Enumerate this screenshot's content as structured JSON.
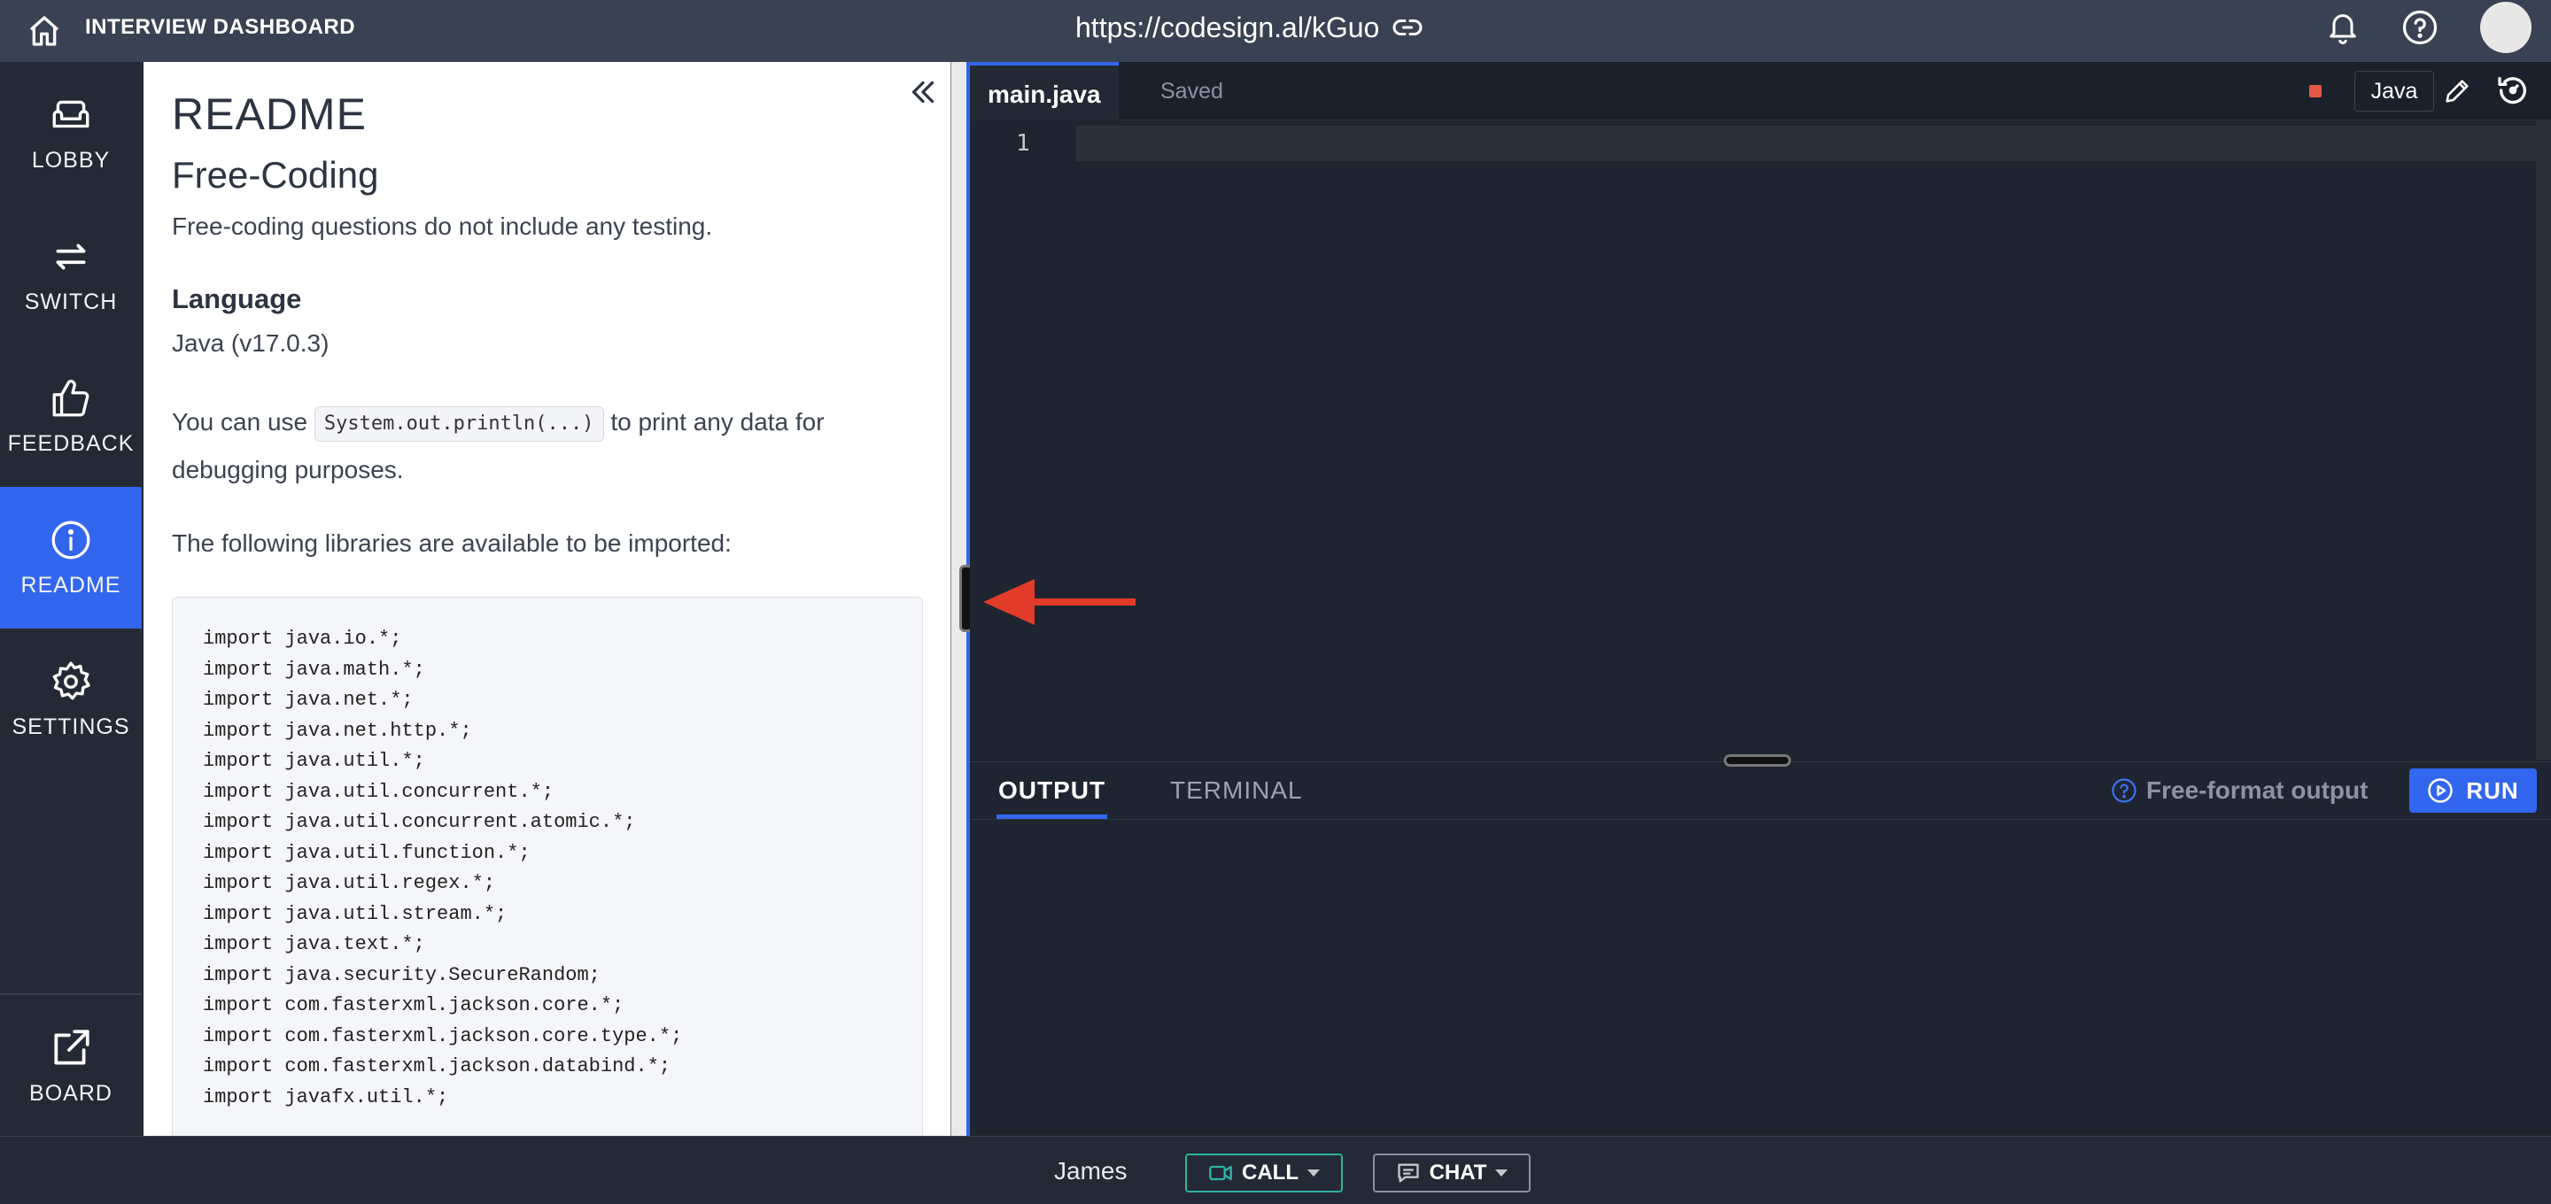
{
  "header": {
    "app_title": "INTERVIEW DASHBOARD",
    "url": "https://codesign.al/kGuo"
  },
  "sidebar": {
    "items": [
      {
        "label": "LOBBY",
        "icon": "sofa-icon"
      },
      {
        "label": "SWITCH",
        "icon": "swap-arrows-icon"
      },
      {
        "label": "FEEDBACK",
        "icon": "thumbs-up-icon"
      },
      {
        "label": "README",
        "icon": "info-icon",
        "active": true
      },
      {
        "label": "SETTINGS",
        "icon": "gear-icon"
      }
    ],
    "board": {
      "label": "BOARD",
      "icon": "external-link-icon"
    }
  },
  "readme": {
    "title": "README",
    "heading": "Free-Coding",
    "intro": "Free-coding questions do not include any testing.",
    "language_heading": "Language",
    "language_value": "Java (v17.0.3)",
    "debug_prefix": "You can use",
    "debug_code": "System.out.println(...)",
    "debug_suffix": "to print any data for debugging purposes.",
    "libraries_intro": "The following libraries are available to be imported:",
    "imports": [
      "import java.io.*;",
      "import java.math.*;",
      "import java.net.*;",
      "import java.net.http.*;",
      "import java.util.*;",
      "import java.util.concurrent.*;",
      "import java.util.concurrent.atomic.*;",
      "import java.util.function.*;",
      "import java.util.regex.*;",
      "import java.util.stream.*;",
      "import java.text.*;",
      "import java.security.SecureRandom;",
      "import com.fasterxml.jackson.core.*;",
      "import com.fasterxml.jackson.core.type.*;",
      "import com.fasterxml.jackson.databind.*;",
      "import javafx.util.*;"
    ]
  },
  "editor": {
    "tab_name": "main.java",
    "save_status": "Saved",
    "language": "Java",
    "line_number": "1"
  },
  "output": {
    "tabs": [
      "OUTPUT",
      "TERMINAL"
    ],
    "format_label": "Free-format output",
    "run_label": "RUN"
  },
  "footer": {
    "user": "James",
    "call_label": "CALL",
    "chat_label": "CHAT"
  },
  "colors": {
    "accent": "#3366ee",
    "topbar": "#384252",
    "editor_bg": "#1f2530",
    "annotation_arrow": "#e23b2a",
    "call_border": "#2fb3a3"
  }
}
